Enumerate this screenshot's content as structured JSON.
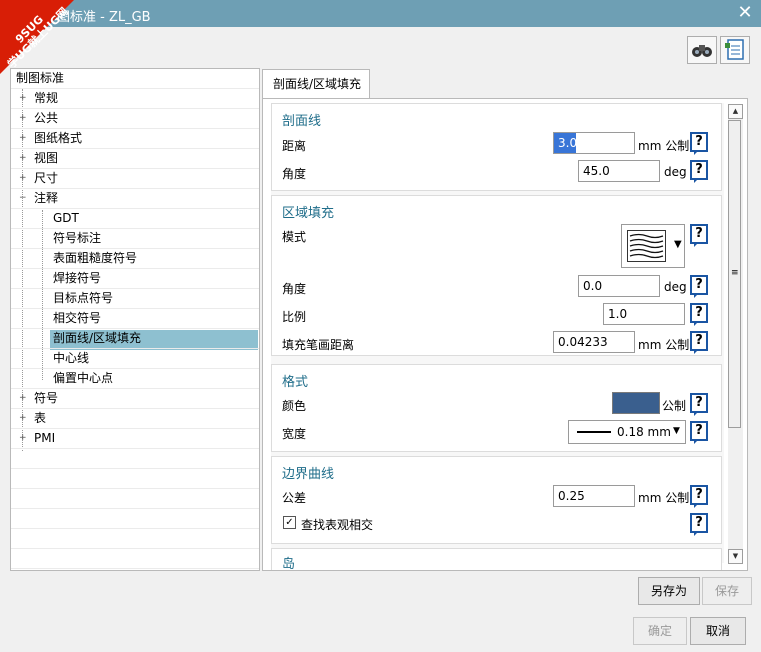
{
  "window": {
    "title": "图标准 - ZL_GB",
    "badge_line1": "9SUG",
    "badge_line2": "学UG就上UG网",
    "close": "✕"
  },
  "toolbar": {
    "find_icon": "binoculars-icon",
    "doc_icon": "document-list-icon"
  },
  "tree": {
    "root": "制图标准",
    "items": [
      {
        "label": "常规",
        "expander": "+"
      },
      {
        "label": "公共",
        "expander": "+"
      },
      {
        "label": "图纸格式",
        "expander": "+"
      },
      {
        "label": "视图",
        "expander": "+"
      },
      {
        "label": "尺寸",
        "expander": "+"
      },
      {
        "label": "注释",
        "expander": "−"
      },
      {
        "label": "GDT"
      },
      {
        "label": "符号标注"
      },
      {
        "label": "表面粗糙度符号"
      },
      {
        "label": "焊接符号"
      },
      {
        "label": "目标点符号"
      },
      {
        "label": "相交符号"
      },
      {
        "label": "剖面线/区域填充"
      },
      {
        "label": "中心线"
      },
      {
        "label": "偏置中心点"
      },
      {
        "label": "符号",
        "expander": "+"
      },
      {
        "label": "表",
        "expander": "+"
      },
      {
        "label": "PMI",
        "expander": "+"
      }
    ]
  },
  "tab": {
    "label": "剖面线/区域填充"
  },
  "sections": {
    "hatch": {
      "title": "剖面线",
      "distance_label": "距离",
      "distance_value": "3.0",
      "distance_unit": "mm 公制",
      "angle_label": "角度",
      "angle_value": "45.0",
      "angle_unit": "deg"
    },
    "area_fill": {
      "title": "区域填充",
      "pattern_label": "模式",
      "angle_label": "角度",
      "angle_value": "0.0",
      "angle_unit": "deg",
      "scale_label": "比例",
      "scale_value": "1.0",
      "pen_label": "填充笔画距离",
      "pen_value": "0.04233",
      "pen_unit": "mm 公制"
    },
    "format": {
      "title": "格式",
      "color_label": "颜色",
      "color_value": "#3a5f8e",
      "color_unit": "公制",
      "width_label": "宽度",
      "width_value": "0.18 mm"
    },
    "boundary": {
      "title": "边界曲线",
      "tolerance_label": "公差",
      "tolerance_value": "0.25",
      "tolerance_unit": "mm 公制",
      "find_label": "查找表观相交",
      "find_checked": true
    },
    "island": {
      "title": "岛"
    }
  },
  "help_glyph": "?",
  "buttons": {
    "save_as": "另存为",
    "save": "保存",
    "ok": "确定",
    "cancel": "取消"
  }
}
